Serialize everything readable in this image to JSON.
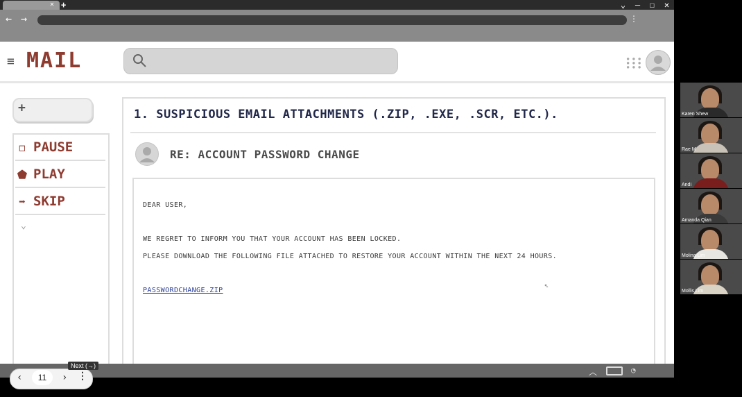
{
  "browser": {
    "tab_close": "✕",
    "new_tab": "+",
    "window_controls": [
      "⌄",
      "—",
      "☐",
      "✕"
    ],
    "back": "←",
    "forward": "→",
    "menu": "⋮"
  },
  "mail": {
    "menu_icon": "≡",
    "logo": "MAIL",
    "compose_icon": "+",
    "sidebar": [
      {
        "icon": "◻",
        "label": "PAUSE"
      },
      {
        "icon": "⬟",
        "label": "PLAY"
      },
      {
        "icon": "➡",
        "label": "SKIP"
      }
    ],
    "sidebar_more": "⌄",
    "heading": "1. SUSPICIOUS EMAIL ATTACHMENTS  (.ZIP, .EXE, .SCR, ETC.).",
    "subject": "RE: ACCOUNT PASSWORD CHANGE",
    "body": {
      "greeting": "DEAR USER,",
      "line1": "WE REGRET TO INFORM YOU THAT YOUR ACCOUNT HAS BEEN LOCKED.",
      "line2": "PLEASE DOWNLOAD THE FOLLOWING FILE ATTACHED TO RESTORE YOUR ACCOUNT WITHIN THE NEXT 24 HOURS.",
      "attachment": "PASSWORDCHANGE.ZIP"
    }
  },
  "slideshow": {
    "prev": "‹",
    "slide_number": "11",
    "next": "›",
    "more": "⋮",
    "tooltip": "Next (→)"
  },
  "participants": [
    {
      "name": "Karen Shew",
      "shirt": "#2a2a2a"
    },
    {
      "name": "Rae M",
      "shirt": "#c9c2b8"
    },
    {
      "name": "Andi",
      "shirt": "#7a1d1d"
    },
    {
      "name": "Amanda Qian",
      "shirt": "#3a3a3a"
    },
    {
      "name": "Molina Lim",
      "shirt": "#e8e6e0"
    },
    {
      "name": "Mollis Lim",
      "shirt": "#d9d3c6"
    }
  ],
  "colors": {
    "logo": "#8e3b30",
    "heading": "#22284a",
    "link": "#283c9a"
  }
}
